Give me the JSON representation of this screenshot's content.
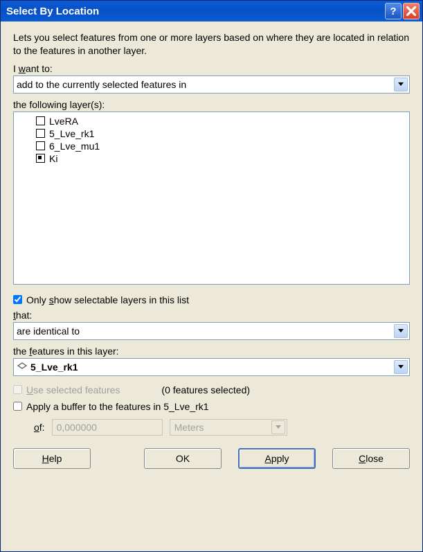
{
  "title": "Select By Location",
  "description": "Lets you select features from one or more layers based on where they are located in relation to the features in another layer.",
  "labels": {
    "i_want_to_pre": "I ",
    "i_want_to_u": "w",
    "i_want_to_post": "ant to:",
    "following_layers": "the following layer(s):",
    "only_selectable_pre": "Only ",
    "only_selectable_u": "s",
    "only_selectable_post": "how selectable layers in this list",
    "that_u": "t",
    "that_post": "hat:",
    "features_layer_pre": "the ",
    "features_layer_u": "f",
    "features_layer_post": "eatures in this layer:",
    "use_selected_u": "U",
    "use_selected_post": "se selected features",
    "features_selected": "(0 features selected)",
    "apply_buffer": "Apply a buffer to the features in 5_Lve_rk1",
    "of_u": "o",
    "of_post": "f:",
    "help_u": "H",
    "help_post": "elp",
    "ok": "OK",
    "apply_u": "A",
    "apply_post": "pply",
    "close_u": "C",
    "close_post": "lose"
  },
  "action_select": "add to the currently selected features in",
  "layers": [
    {
      "name": "LveRA",
      "checked": false
    },
    {
      "name": "5_Lve_rk1",
      "checked": false
    },
    {
      "name": "6_Lve_mu1",
      "checked": false
    },
    {
      "name": "Ki",
      "checked": true
    }
  ],
  "only_selectable_checked": true,
  "spatial_method": "are identical to",
  "target_layer": "5_Lve_rk1",
  "use_selected_checked": false,
  "apply_buffer_checked": false,
  "buffer_value": "0,000000",
  "buffer_unit": "Meters"
}
